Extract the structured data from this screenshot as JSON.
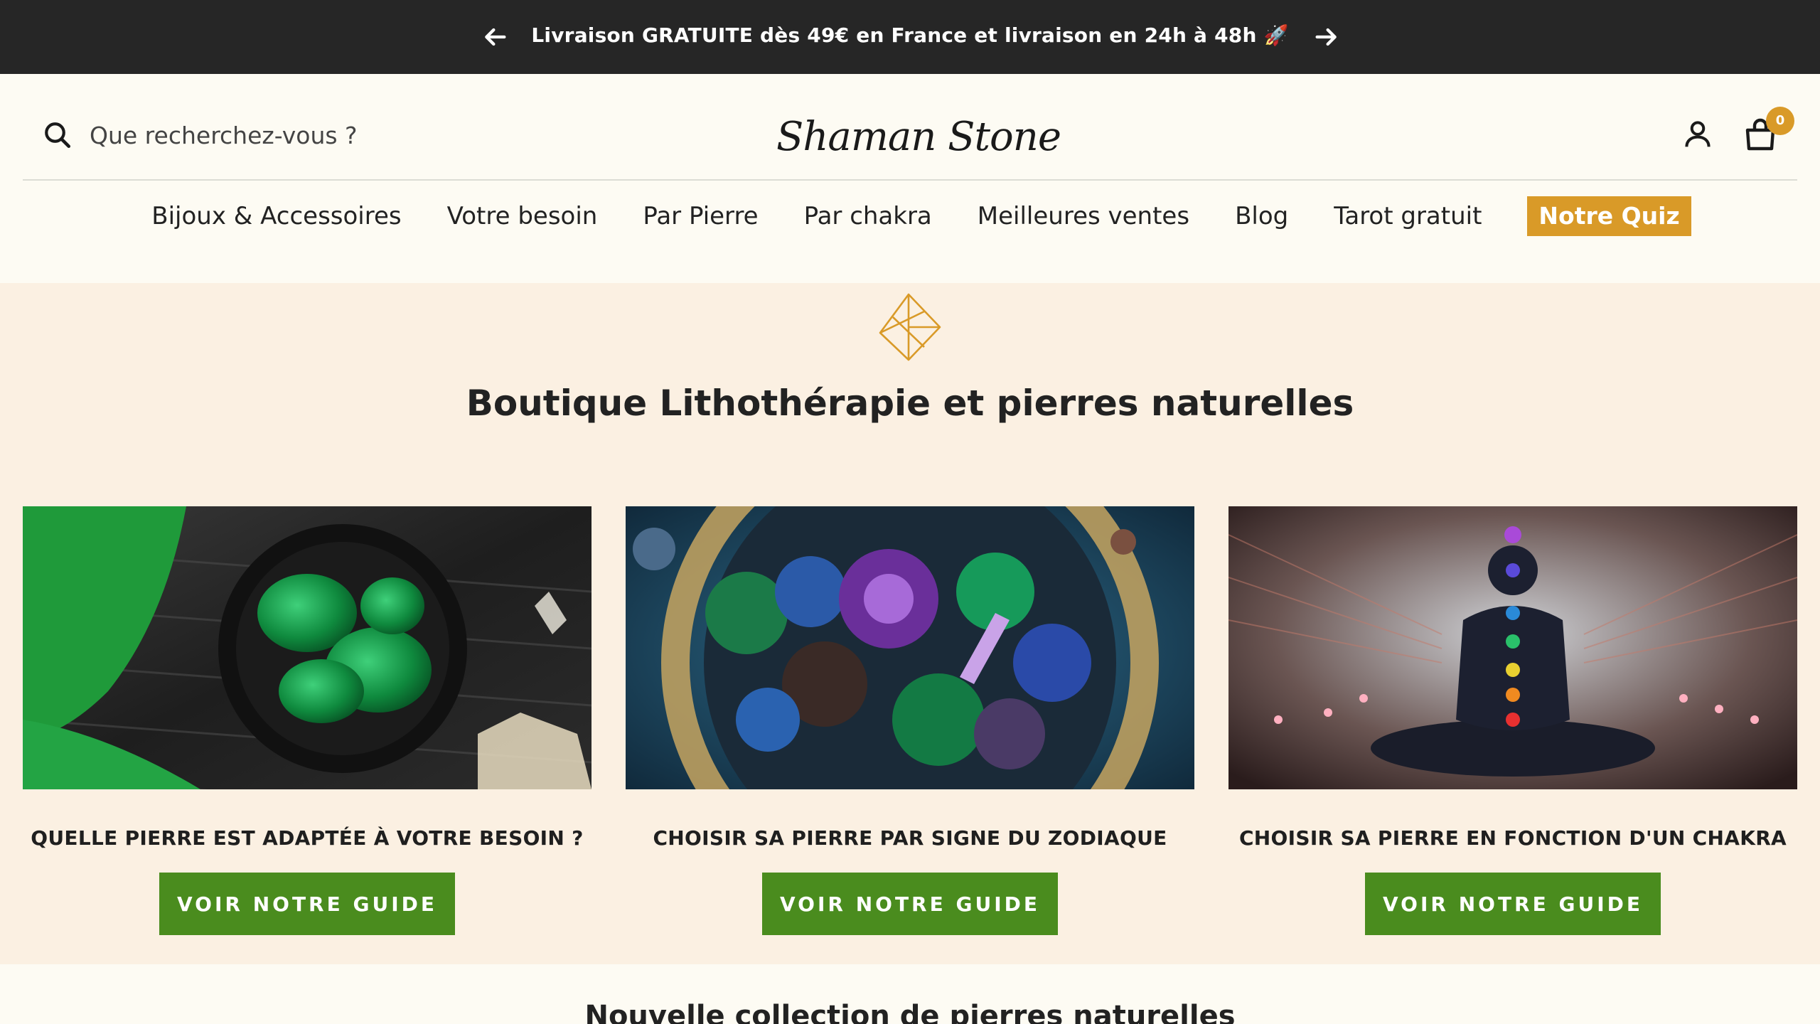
{
  "announcement": {
    "text": "Livraison GRATUITE dès 49€ en France et livraison en 24h à 48h 🚀",
    "prev_icon": "arrow-left-icon",
    "next_icon": "arrow-right-icon"
  },
  "header": {
    "search_placeholder": "Que recherchez-vous ?",
    "logo_text": "Shaman Stone",
    "cart_count": "0"
  },
  "nav": {
    "items": [
      {
        "label": "Bijoux & Accessoires"
      },
      {
        "label": "Votre besoin"
      },
      {
        "label": "Par Pierre"
      },
      {
        "label": "Par chakra"
      },
      {
        "label": "Meilleures ventes"
      },
      {
        "label": "Blog"
      },
      {
        "label": "Tarot gratuit"
      }
    ],
    "quiz_label": "Notre Quiz"
  },
  "hero": {
    "title": "Boutique Lithothérapie et pierres naturelles",
    "cards": [
      {
        "title": "QUELLE PIERRE EST ADAPTÉE À VOTRE BESOIN ?",
        "button": "VOIR NOTRE GUIDE"
      },
      {
        "title": "CHOISIR SA PIERRE PAR SIGNE DU ZODIAQUE",
        "button": "VOIR NOTRE GUIDE"
      },
      {
        "title": "CHOISIR SA PIERRE EN FONCTION D'UN CHAKRA",
        "button": "VOIR NOTRE GUIDE"
      }
    ]
  },
  "next_section": {
    "title": "Nouvelle collection de pierres naturelles"
  },
  "colors": {
    "announcement_bg": "#262626",
    "accent_gold": "#d99a28",
    "button_green": "#4a8c1e",
    "hero_bg": "#fbf0e2"
  }
}
